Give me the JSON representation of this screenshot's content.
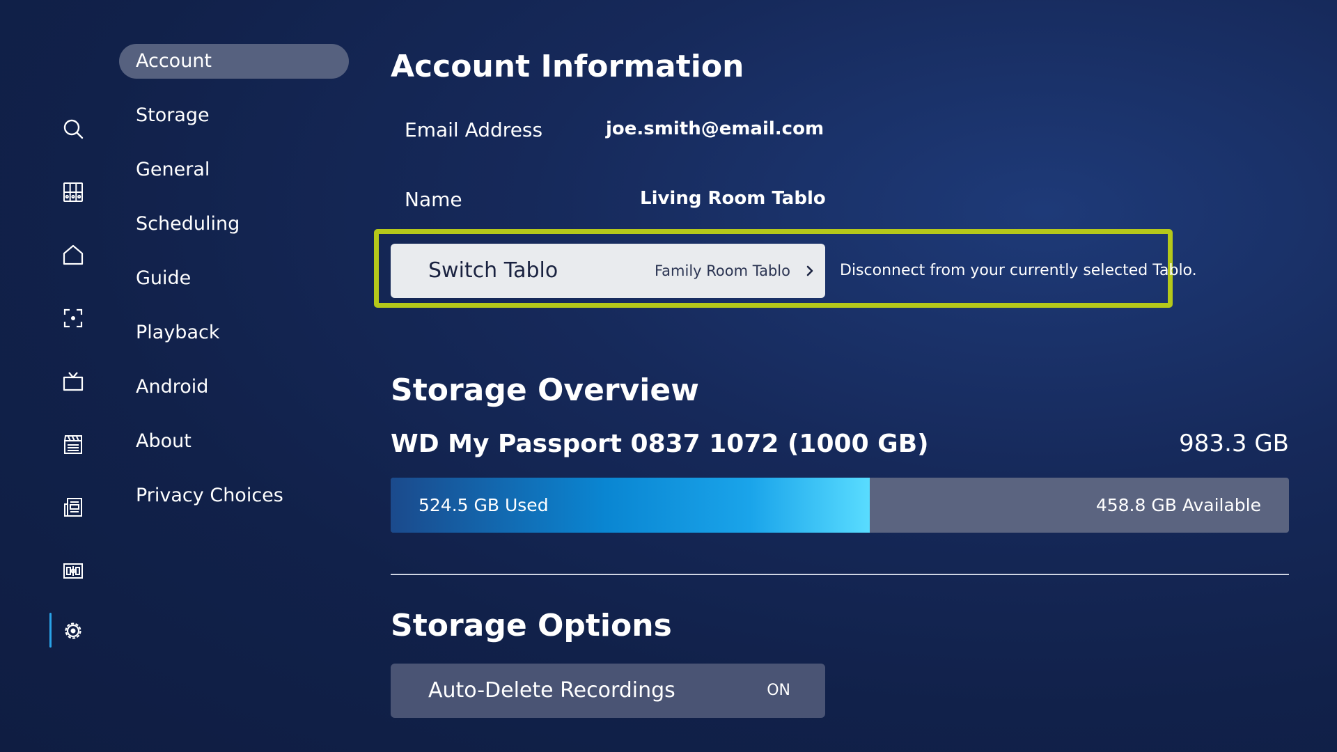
{
  "rail": {
    "icons": [
      "search-icon",
      "guide-grid-icon",
      "home-icon",
      "live-focus-icon",
      "tv-icon",
      "movies-clapper-icon",
      "sports-icon",
      "recordings-icon",
      "settings-gear-icon"
    ],
    "active_index": 8,
    "active_color": "#29a3e8"
  },
  "menu": {
    "items": [
      {
        "label": "Account",
        "selected": true
      },
      {
        "label": "Storage"
      },
      {
        "label": "General"
      },
      {
        "label": "Scheduling"
      },
      {
        "label": "Guide"
      },
      {
        "label": "Playback"
      },
      {
        "label": "Android"
      },
      {
        "label": "About"
      },
      {
        "label": "Privacy Choices"
      }
    ]
  },
  "account": {
    "heading": "Account Information",
    "email_label": "Email Address",
    "email_value": "joe.smith@email.com",
    "name_label": "Name",
    "name_value": "Living Room Tablo",
    "switch": {
      "label": "Switch Tablo",
      "current": "Family Room Tablo",
      "description": "Disconnect from your currently selected Tablo."
    },
    "focus_color": "#b5c81a"
  },
  "storage_overview": {
    "heading": "Storage Overview",
    "drive_name": "WD My Passport 0837 1072 (1000 GB)",
    "total": "983.3 GB",
    "used_label": "524.5 GB Used",
    "available_label": "458.8 GB Available",
    "used_gb": 524.5,
    "available_gb": 458.8
  },
  "storage_options": {
    "heading": "Storage Options",
    "auto_delete_label": "Auto-Delete Recordings",
    "auto_delete_value": "ON"
  }
}
